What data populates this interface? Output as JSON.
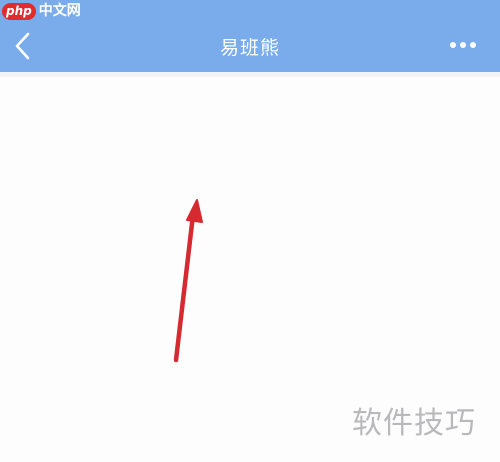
{
  "site_logo": {
    "badge": "php",
    "text": "中文网"
  },
  "navbar": {
    "title": "易班熊",
    "back_icon": "chevron-left-icon",
    "more_icon": "more-horizontal-icon",
    "background_color": "#7aaceb"
  },
  "annotation": {
    "arrow_icon": "red-arrow-annotation",
    "color": "#d42a30"
  },
  "watermark": {
    "text": "软件技巧"
  }
}
